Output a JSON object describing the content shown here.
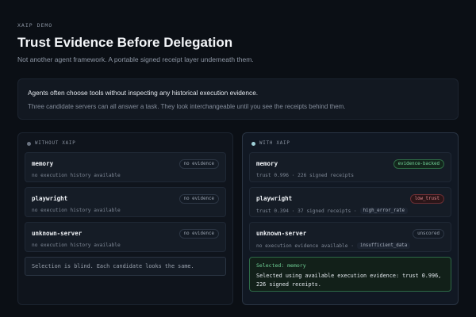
{
  "header": {
    "eyebrow": "XAIP DEMO",
    "title": "Trust Evidence Before Delegation",
    "subtitle": "Not another agent framework. A portable signed receipt layer underneath them."
  },
  "intro": {
    "main": "Agents often choose tools without inspecting any historical execution evidence.",
    "sub": "Three candidate servers can all answer a task. They look interchangeable until you see the receipts behind them."
  },
  "without": {
    "label": "WITHOUT XAIP",
    "items": [
      {
        "name": "memory",
        "meta": "no execution history available",
        "badge": "no evidence"
      },
      {
        "name": "playwright",
        "meta": "no execution history available",
        "badge": "no evidence"
      },
      {
        "name": "unknown-server",
        "meta": "no execution history available",
        "badge": "no evidence"
      }
    ],
    "note": "Selection is blind. Each candidate looks the same."
  },
  "with": {
    "label": "WITH XAIP",
    "items": [
      {
        "name": "memory",
        "meta": "trust 0.996 · 226 signed receipts",
        "badge": "evidence-backed"
      },
      {
        "name": "playwright",
        "meta": "trust 0.394 · 37 signed receipts ·",
        "flag": "high_error_rate",
        "badge": "low_trust"
      },
      {
        "name": "unknown-server",
        "meta": "no execution evidence available ·",
        "flag": "insufficient_data",
        "badge": "unscored"
      }
    ],
    "selected": {
      "title": "Selected: memory",
      "text": "Selected using available execution evidence: trust 0.996, 226 signed receipts."
    }
  },
  "colors": {
    "background": "#0b0f15",
    "accent_green": "#70d196",
    "accent_red": "#e28a90"
  }
}
